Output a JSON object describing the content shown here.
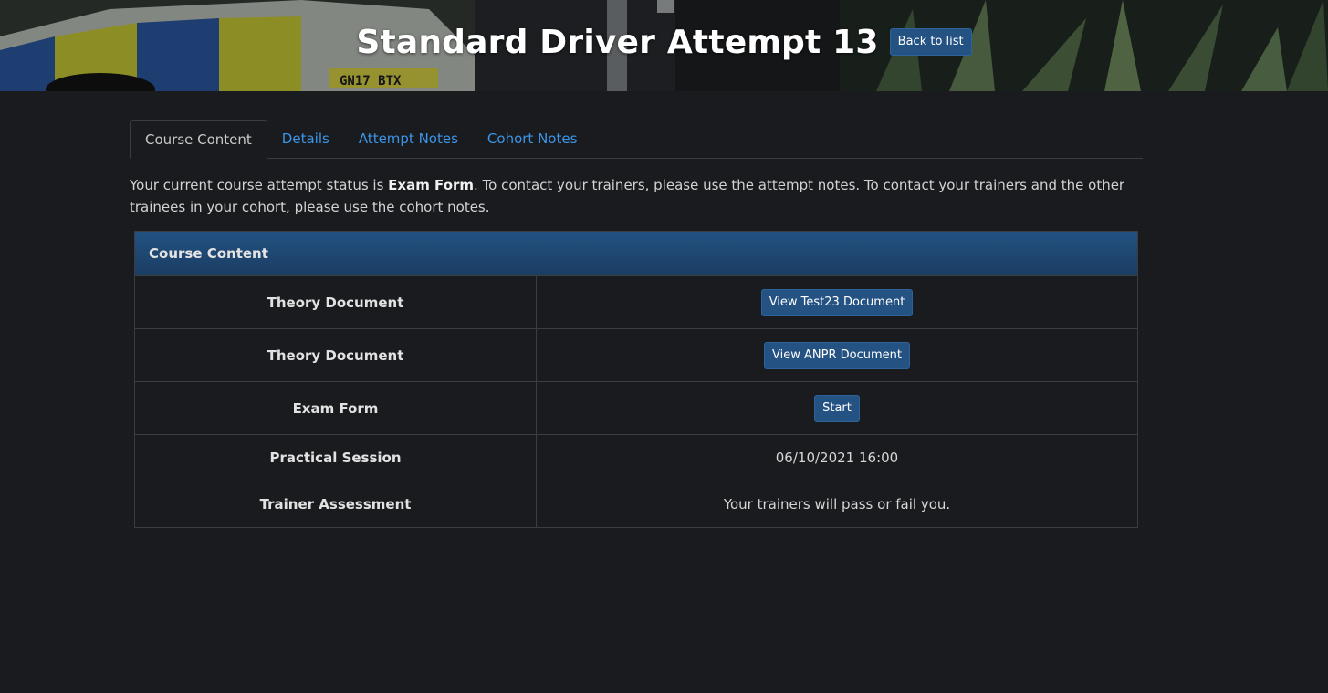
{
  "header": {
    "title": "Standard Driver Attempt 13",
    "back_label": "Back to list"
  },
  "tabs": [
    {
      "label": "Course Content",
      "active": true
    },
    {
      "label": "Details",
      "active": false
    },
    {
      "label": "Attempt Notes",
      "active": false
    },
    {
      "label": "Cohort Notes",
      "active": false
    }
  ],
  "status": {
    "prefix": "Your current course attempt status is ",
    "value": "Exam Form",
    "suffix": ". To contact your trainers, please use the attempt notes. To contact your trainers and the other trainees in your cohort, please use the cohort notes."
  },
  "panel": {
    "title": "Course Content",
    "rows": [
      {
        "label": "Theory Document",
        "type": "button",
        "value": "View Test23 Document"
      },
      {
        "label": "Theory Document",
        "type": "button",
        "value": "View ANPR Document"
      },
      {
        "label": "Exam Form",
        "type": "button",
        "value": "Start"
      },
      {
        "label": "Practical Session",
        "type": "text",
        "value": "06/10/2021 16:00"
      },
      {
        "label": "Trainer Assessment",
        "type": "text",
        "value": "Your trainers will pass or fail you."
      }
    ]
  },
  "colors": {
    "accent": "#235283",
    "link": "#3b95e8",
    "background": "#1a1b1e"
  }
}
